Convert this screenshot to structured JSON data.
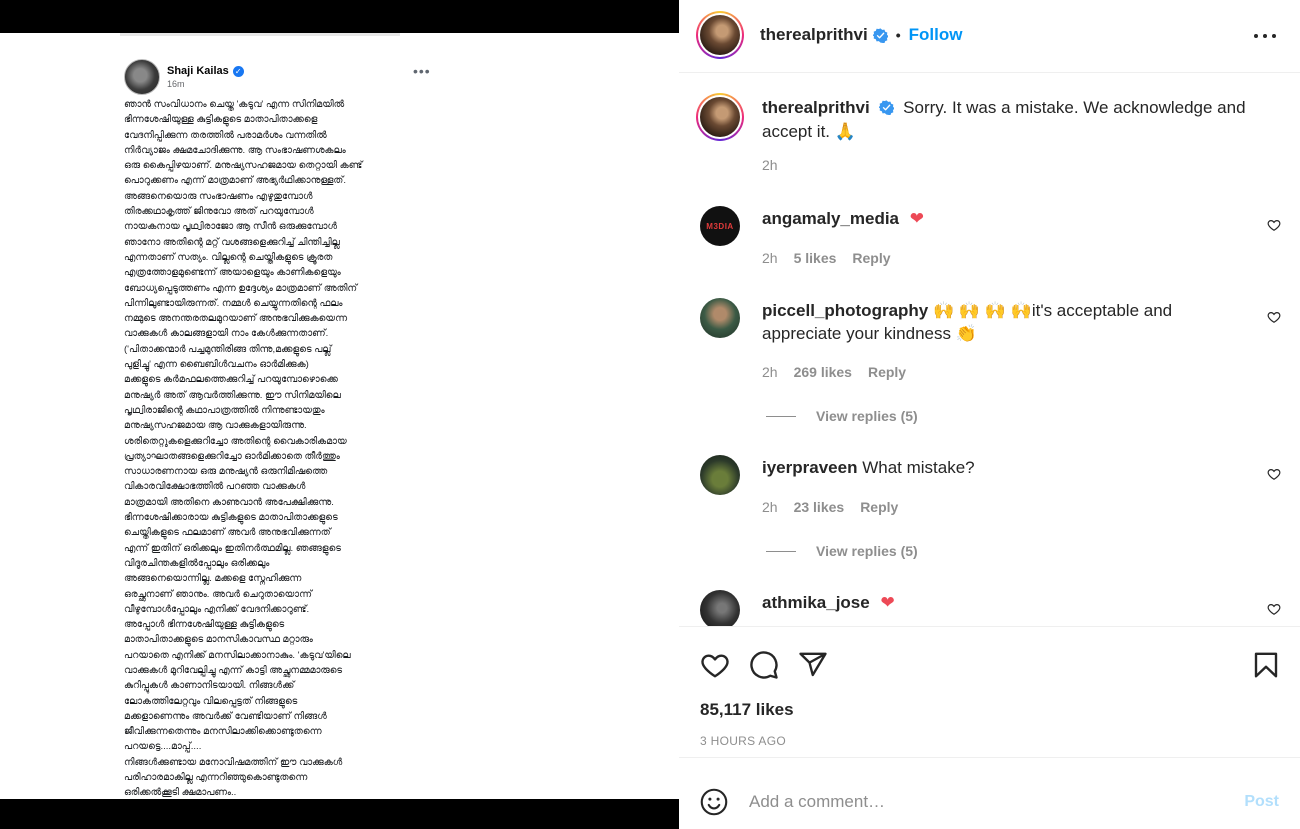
{
  "media": {
    "author": "Shaji Kailas",
    "time": "16m",
    "lines": [
      "ഞാൻ സംവിധാനം ചെയ്ത 'കടുവ' എന്ന സിനിമയിൽ",
      "ഭിന്നശേഷിയുള്ള കുട്ടികളുടെ മാതാപിതാക്കളെ",
      "വേദനിപ്പിക്കുന്ന തരത്തിൽ പരാമർശം വന്നതിൽ",
      "നിർവ്യാജം ക്ഷമചോദിക്കുന്നു. ആ സംഭാഷണശകലം",
      "ഒരു കൈപ്പിഴയാണ്. മനുഷ്യസഹജമായ തെറ്റായി കണ്ട്",
      "പൊറുക്കണം എന്ന് മാത്രമാണ് അഭ്യർഥിക്കാനുള്ളത്.",
      "അങ്ങനെയൊരു സംഭാഷണം എഴുതുമ്പോൾ",
      "തിരക്കഥാകൃത്ത് ജിനുവോ അത് പറയുമ്പോൾ",
      "നായകനായ പൃഥ്വിരാജോ ആ സീൻ ഒരുക്കുമ്പോൾ",
      "ഞാനോ അതിന്റെ മറ്റ് വശങ്ങളെക്കുറിച്ച് ചിന്തിച്ചില്ല",
      "എന്നതാണ് സത്യം. വില്ലന്റെ ചെയ്തികളുടെ ക്രൂരത",
      "എത്രത്തോളമുണ്ടെന്ന് അയാളെയും കാണികളെയും",
      "ബോധ്യപ്പെടുത്തണം എന്ന ഉദ്ദേശ്യം മാത്രമാണ് അതിന്",
      "പിന്നിലുണ്ടായിരുന്നത്. നമ്മൾ ചെയ്യുന്നതിന്റെ ഫലം",
      "നമ്മുടെ അനന്തരതലമുറയാണ് അനുഭവിക്കുകയെന്ന",
      "വാക്കുകൾ കാലങ്ങളായി നാം കേൾക്കുന്നതാണ്.",
      "('പിതാക്കന്മാർ പച്ചമുന്തിരിങ്ങ തിന്നു,മക്കളുടെ പല്ല്",
      "പുളിച്ചു' എന്ന ബൈബിൾവചനം ഓർമിക്കുക)",
      "മക്കളുടെ കർമഫലത്തെക്കുറിച്ച് പറയുമ്പോഴൊക്കെ",
      "മനുഷ്യർ അത് ആവർത്തിക്കുന്നു. ഈ സിനിമയിലെ",
      "പൃഥ്വിരാജിന്റെ കഥാപാത്രത്തിൽ നിന്നുണ്ടായതും",
      "മനുഷ്യസഹജമായ ആ വാക്കുകളായിരുന്നു.",
      "ശരിതെറ്റുകളെക്കുറിച്ചോ അതിന്റെ വൈകാരികമായ",
      "പ്രത്യാഘാതങ്ങളെക്കുറിച്ചോ ഓർമിക്കാതെ തീർത്തും",
      "സാധാരണനായ ഒരു മനുഷ്യൻ ഒരുനിമിഷത്തെ",
      "വികാരവിക്ഷോഭത്തിൽ പറഞ്ഞ വാക്കുകൾ",
      "മാത്രമായി അതിനെ കാണുവാൻ അപേക്ഷിക്കുന്നു.",
      "ഭിന്നശേഷിക്കാരായ കുട്ടികളുടെ മാതാപിതാക്കളുടെ",
      "ചെയ്തികളുടെ ഫലമാണ് അവർ അനുഭവിക്കുന്നത്",
      "എന്ന് ഇതിന് ഒരിക്കലും ഇതിനർത്ഥമില്ല. ഞങ്ങളുടെ",
      "വിദൂരചിന്തകളിൽപ്പോലും ഒരിക്കലും",
      "അങ്ങനെയൊന്നില്ല. മക്കളെ സ്നേഹിക്കുന്ന",
      "ഒരച്ഛനാണ് ഞാനും. അവർ ചെറുതായൊന്ന്",
      "വീഴുമ്പോൾപ്പോലും എനിക്ക് വേദനിക്കാറുണ്ട്.",
      "അപ്പോൾ ഭിന്നശേഷിയുള്ള കുട്ടികളുടെ",
      "മാതാപിതാക്കളുടെ മാനസികാവസ്ഥ മറ്റാരും",
      "പറയാതെ എനിക്ക് മനസിലാക്കാനാകും. 'കടുവ'യിലെ",
      "വാക്കുകൾ മുറിവേല്പിച്ചു എന്ന് കാട്ടി അച്ഛനമ്മമാരുടെ",
      "കുറിപ്പുകൾ കാണാനിടയായി. നിങ്ങൾക്ക്",
      "ലോകത്തിലേറ്റവും വിലപ്പെട്ടത് നിങ്ങളുടെ",
      "മക്കളാണെന്നും അവർക്ക് വേണ്ടിയാണ് നിങ്ങൾ",
      "ജീവിക്കുന്നതെന്നും മനസിലാക്കിക്കൊണ്ടുതന്നെ",
      "പറയട്ടെ....മാപ്പ്....",
      "നിങ്ങൾക്കുണ്ടായ മനോവിഷമത്തിന് ഈ വാക്കുകൾ",
      "പരിഹാരമാകില്ല എന്നറിഞ്ഞുകൊണ്ടുതന്നെ",
      "ഒരിക്കൽക്കൂടി ക്ഷമാപണം.."
    ]
  },
  "header": {
    "username": "therealprithvi",
    "separator": "•",
    "follow_label": "Follow"
  },
  "caption": {
    "username": "therealprithvi",
    "text": "Sorry. It was a mistake. We acknowledge and accept it.",
    "emoji": "🙏",
    "time": "2h"
  },
  "comments": [
    {
      "username": "angamaly_media",
      "text": "",
      "emoji": "❤",
      "time": "2h",
      "likes": "5 likes",
      "reply_label": "Reply"
    },
    {
      "username": "piccell_photography",
      "text": "🙌 🙌 🙌 🙌it's acceptable and appreciate your kindness 👏",
      "time": "2h",
      "likes": "269 likes",
      "reply_label": "Reply",
      "view_replies": "View replies (5)"
    },
    {
      "username": "iyerpraveen",
      "text": "What mistake?",
      "time": "2h",
      "likes": "23 likes",
      "reply_label": "Reply",
      "view_replies": "View replies (5)"
    },
    {
      "username": "athmika_jose",
      "text": "",
      "emoji": "❤"
    }
  ],
  "stats": {
    "likes": "85,117 likes",
    "posted": "3 HOURS AGO"
  },
  "add_comment": {
    "placeholder": "Add a comment…",
    "post_label": "Post"
  },
  "colors": {
    "accent": "#0095f6",
    "verified": "#3897f0",
    "muted": "#8e8e8e",
    "heart_red": "#ed4956",
    "post_disabled": "#b2dffc"
  }
}
